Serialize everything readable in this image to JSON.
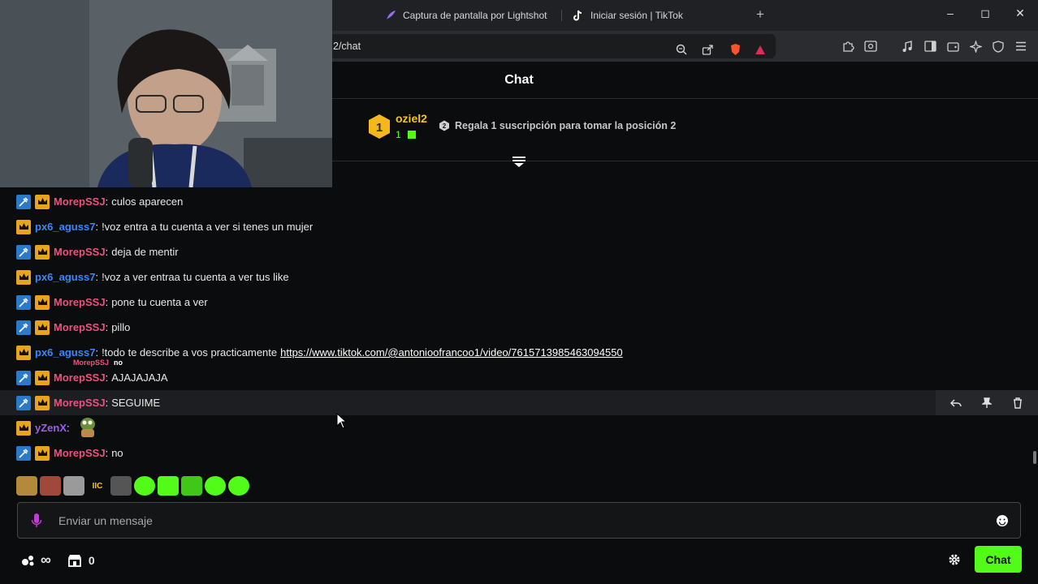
{
  "browser": {
    "tabs": [
      {
        "label": "Captura de pantalla por Lightshot"
      },
      {
        "label": "Iniciar sesión | TikTok"
      }
    ],
    "new_tab_symbol": "+",
    "url_fragment": "2/chat",
    "window_controls": {
      "minimize": "–",
      "maximize": "◻",
      "close": "✕"
    }
  },
  "chat": {
    "title": "Chat",
    "leader": {
      "rank": "1",
      "name": "oziel2",
      "count": "1",
      "gift_prompt_rank": "2",
      "gift_prompt": "Regala 1 suscripción para tomar la posición 2"
    },
    "overlay_tip": {
      "user": "MorepSSJ",
      "text": "no"
    },
    "messages": [
      {
        "user": "MorepSSJ",
        "text": "culos aparecen"
      },
      {
        "user": "px6_aguss7",
        "text": "!voz entra a tu cuenta a ver si tenes un mujer"
      },
      {
        "user": "MorepSSJ",
        "text": "deja de mentir"
      },
      {
        "user": "px6_aguss7",
        "text": "!voz a ver entraa tu cuenta a ver tus like"
      },
      {
        "user": "MorepSSJ",
        "text": "pone tu cuenta a ver"
      },
      {
        "user": "MorepSSJ",
        "text": "pillo"
      },
      {
        "user": "px6_aguss7",
        "text": "!todo te describe a vos practicamente",
        "link": "https://www.tiktok.com/@antonioofrancoo1/video/7615713985463094550"
      },
      {
        "user": "MorepSSJ",
        "text": "AJAJAJAJA"
      },
      {
        "user": "MorepSSJ",
        "text": "SEGUIME"
      },
      {
        "user": "yZenX",
        "text": ""
      },
      {
        "user": "MorepSSJ",
        "text": "no"
      }
    ],
    "emote_strip_text": "IIC",
    "input": {
      "placeholder": "Enviar un mensaje"
    },
    "bottom": {
      "infinity": "∞",
      "store_count": "0",
      "send_label": "Chat"
    }
  },
  "colors": {
    "accent": "#53fc18",
    "mod_user": "#f0507f",
    "user_blue": "#3a86ff",
    "user_purple": "#9d5bf5",
    "leader": "#f5c518"
  }
}
